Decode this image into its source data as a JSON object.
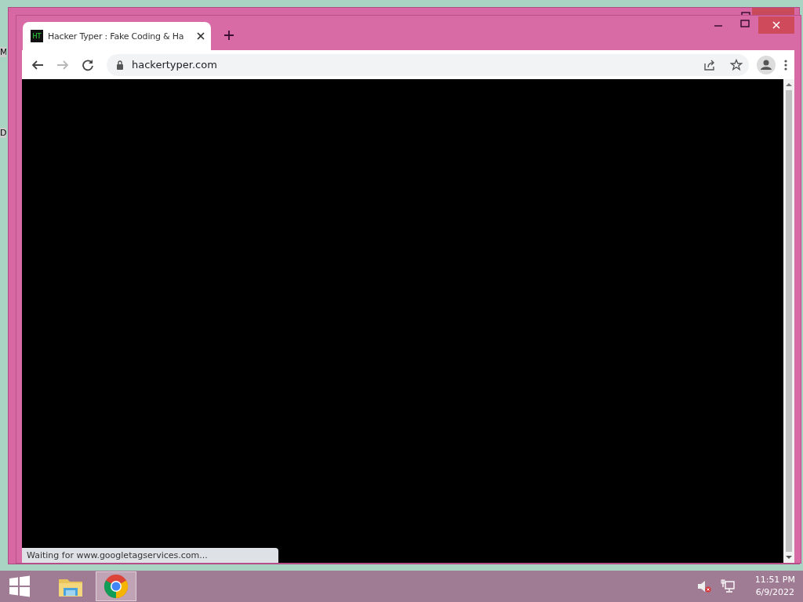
{
  "desktop": {
    "icons": [
      {
        "label": "M"
      },
      {
        "label": "D"
      }
    ]
  },
  "browser": {
    "tabs": [
      {
        "title": "Hacker Typer : Fake Coding & Ha",
        "favicon": "HT",
        "selected": true
      }
    ],
    "address": "hackertyper.com",
    "forward_disabled": true,
    "status": "Waiting for www.googletagservices.com..."
  },
  "taskbar": {
    "apps": [
      {
        "kind": "explorer",
        "selected": false
      },
      {
        "kind": "chrome",
        "selected": true
      }
    ],
    "time": "11:51 PM",
    "date": "6/9/2022",
    "muted": true
  }
}
